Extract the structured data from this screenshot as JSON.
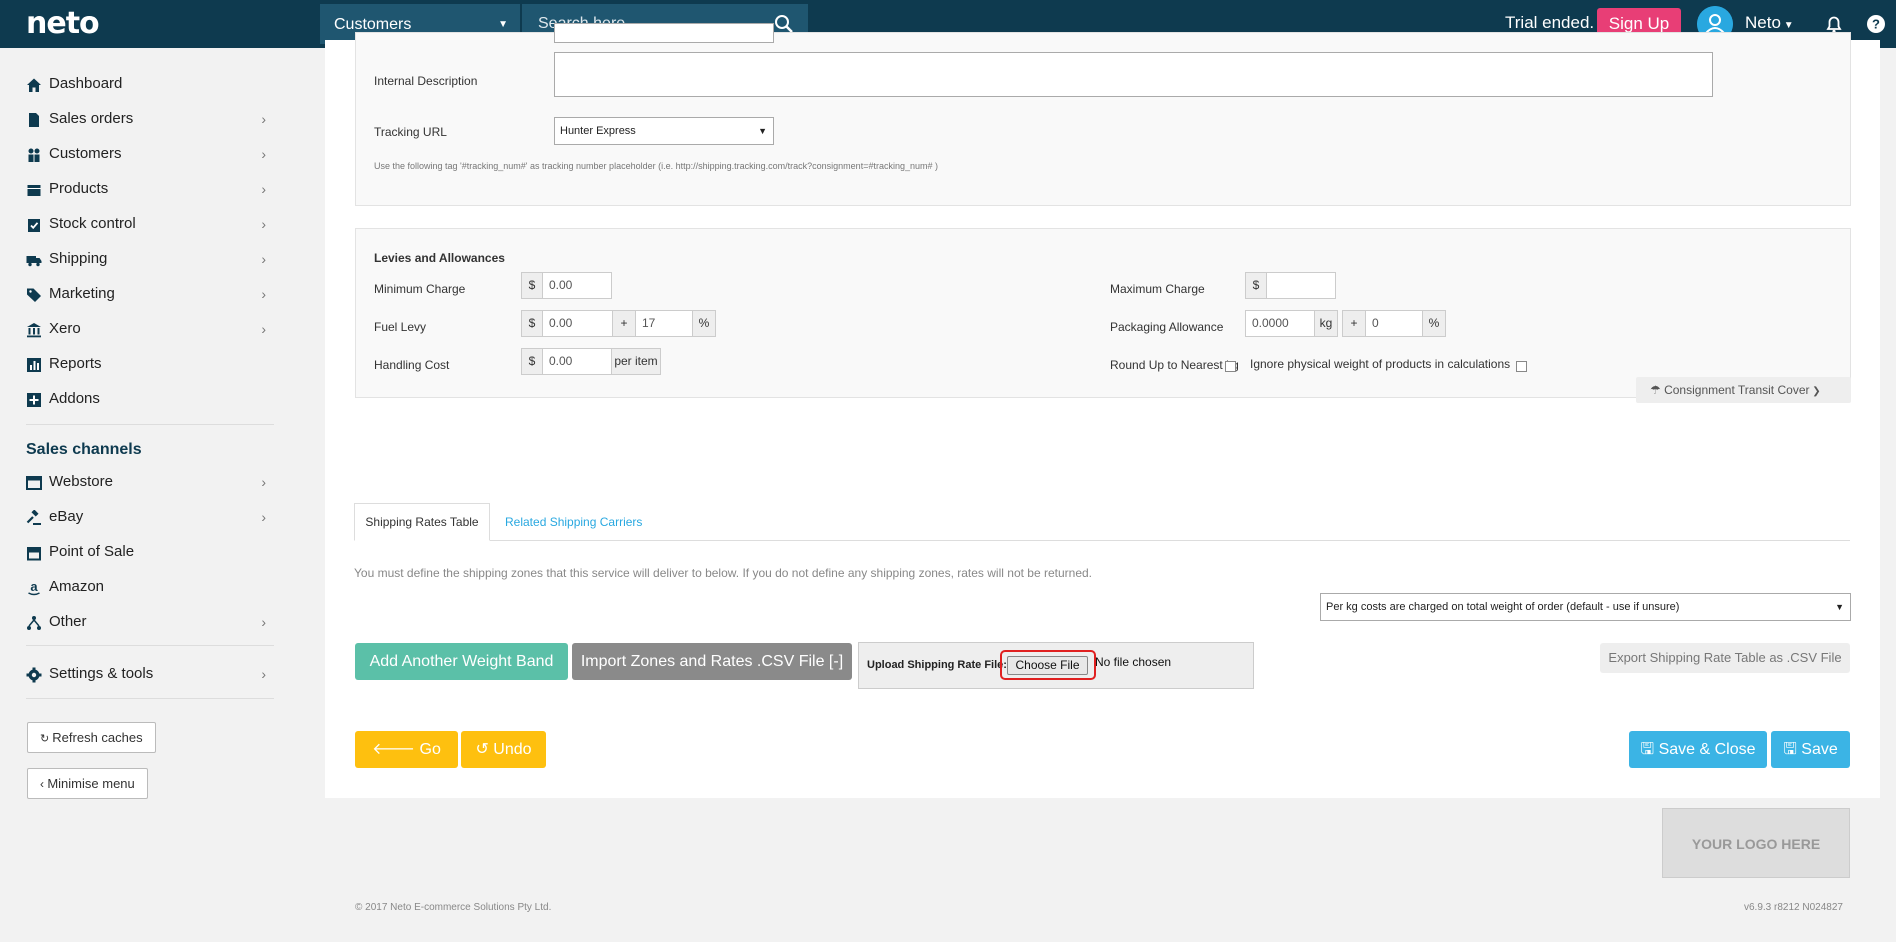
{
  "topbar": {
    "logo": "neto",
    "scope_select": "Customers",
    "search_placeholder": "Search here...",
    "trial_text": "Trial ended.",
    "signup_label": "Sign Up",
    "user_name": "Neto"
  },
  "sidebar": {
    "items": [
      {
        "label": "Dashboard",
        "icon": "home-icon"
      },
      {
        "label": "Sales orders",
        "icon": "document-icon"
      },
      {
        "label": "Customers",
        "icon": "users-icon"
      },
      {
        "label": "Products",
        "icon": "box-icon"
      },
      {
        "label": "Stock control",
        "icon": "clipboard-check-icon"
      },
      {
        "label": "Shipping",
        "icon": "truck-icon"
      },
      {
        "label": "Marketing",
        "icon": "tags-icon"
      },
      {
        "label": "Xero",
        "icon": "bank-icon"
      },
      {
        "label": "Reports",
        "icon": "bar-chart-icon"
      },
      {
        "label": "Addons",
        "icon": "plus-square-icon"
      }
    ],
    "channels_heading": "Sales channels",
    "channels": [
      {
        "label": "Webstore",
        "icon": "window-icon"
      },
      {
        "label": "eBay",
        "icon": "gavel-icon"
      },
      {
        "label": "Point of Sale",
        "icon": "store-icon"
      },
      {
        "label": "Amazon",
        "icon": "amazon-icon"
      },
      {
        "label": "Other",
        "icon": "sitemap-icon"
      }
    ],
    "settings": {
      "label": "Settings & tools",
      "icon": "gear-icon"
    },
    "refresh_label": "Refresh caches",
    "minimise_label": "Minimise menu"
  },
  "form": {
    "internal_description_label": "Internal Description",
    "tracking_url_label": "Tracking URL",
    "tracking_url_value": "Hunter Express",
    "tracking_hint": "Use the following tag '#tracking_num#' as tracking number placeholder (i.e. http://shipping.tracking.com/track?consignment=#tracking_num# )"
  },
  "levies": {
    "heading": "Levies and Allowances",
    "min_charge_label": "Minimum Charge",
    "min_charge_value": "0.00",
    "max_charge_label": "Maximum Charge",
    "max_charge_value": "",
    "fuel_levy_label": "Fuel Levy",
    "fuel_levy_value": "0.00",
    "fuel_levy_pct": "17",
    "packaging_label": "Packaging Allowance",
    "packaging_value": "0.0000",
    "packaging_pct": "0",
    "handling_label": "Handling Cost",
    "handling_value": "0.00",
    "per_item": "per item",
    "round_up_label": "Round Up to Nearest kg",
    "ignore_weight_label": "Ignore physical weight of products in calculations",
    "currency": "$",
    "plus": "+",
    "percent": "%",
    "kg": "kg"
  },
  "transit_cover_label": "Consignment Transit Cover",
  "tabs": {
    "rates": "Shipping Rates Table",
    "carriers": "Related Shipping Carriers"
  },
  "zones_notice": "You must define the shipping zones that this service will deliver to below. If you do not define any shipping zones, rates will not be returned.",
  "charge_mode": "Per kg costs are charged on total weight of order (default - use if unsure)",
  "actions": {
    "add_band": "Add Another Weight Band",
    "import": "Import Zones and Rates .CSV File [-]",
    "upload_label": "Upload Shipping Rate File:",
    "choose_file": "Choose File",
    "no_file": "No file chosen",
    "export": "Export Shipping Rate Table as .CSV File",
    "go_back": "Go Back",
    "undo": "Undo",
    "save_close": "Save & Close",
    "save": "Save"
  },
  "footer": {
    "logo_placeholder": "YOUR LOGO HERE",
    "copyright": "© 2017 Neto E-commerce Solutions Pty Ltd.",
    "version": "v6.9.3 r8212 N024827"
  },
  "colors": {
    "topbar": "#0e3a4f",
    "signup": "#e83e76",
    "teal": "#5bc0a8",
    "gray_btn": "#8a8a8a",
    "yellow": "#fec00f",
    "blue": "#3bb4e5"
  }
}
